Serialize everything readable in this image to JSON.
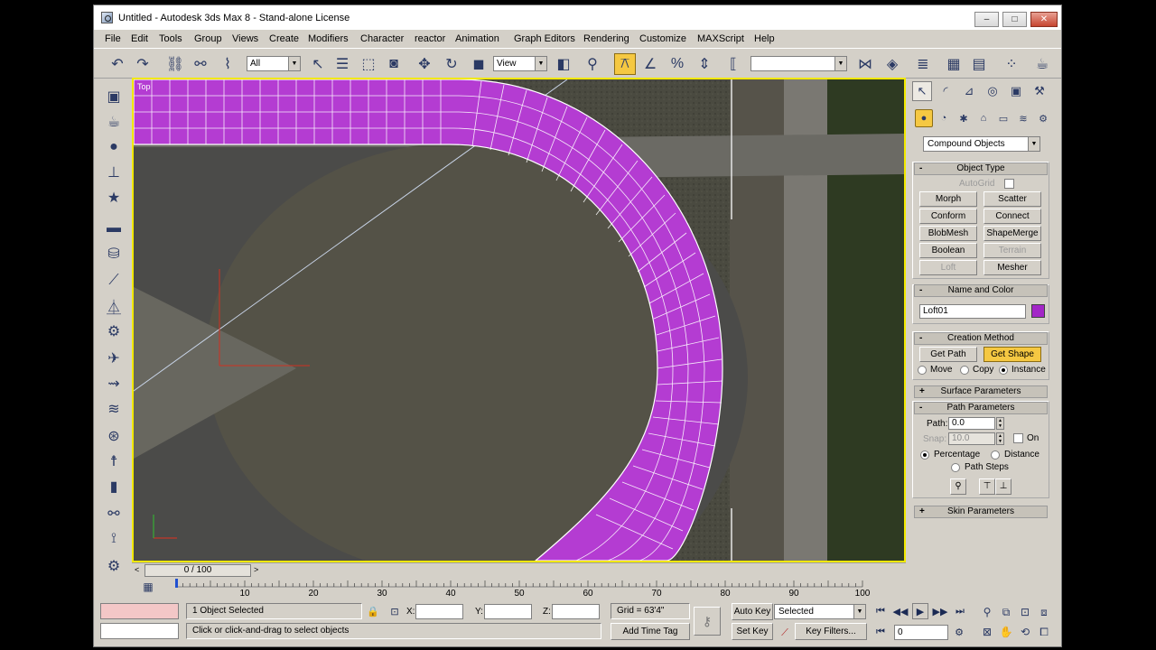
{
  "window": {
    "title": "Untitled - Autodesk 3ds Max 8  - Stand-alone License",
    "minimize": "–",
    "maximize": "□",
    "close": "✕"
  },
  "menu": [
    "File",
    "Edit",
    "Tools",
    "Group",
    "Views",
    "Create",
    "Modifiers",
    "Character",
    "reactor",
    "Animation",
    "Graph Editors",
    "Rendering",
    "Customize",
    "MAXScript",
    "Help"
  ],
  "toolbar": {
    "selection_filter": "All",
    "reference_coord": "View",
    "named_selection": ""
  },
  "viewport": {
    "label": "Top",
    "loft_color": "#b43cd2",
    "active_border_color": "#f2e900"
  },
  "command_panel": {
    "category": "Compound Objects",
    "object_type": {
      "title": "Object Type",
      "autogrid_label": "AutoGrid",
      "buttons": [
        "Morph",
        "Scatter",
        "Conform",
        "Connect",
        "BlobMesh",
        "ShapeMerge",
        "Boolean",
        "Terrain",
        "Loft",
        "Mesher"
      ]
    },
    "name_and_color": {
      "title": "Name and Color",
      "name": "Loft01",
      "color": "#a326c7"
    },
    "creation_method": {
      "title": "Creation Method",
      "get_path": "Get Path",
      "get_shape": "Get Shape",
      "move": "Move",
      "copy": "Copy",
      "instance": "Instance"
    },
    "surface_parameters": "Surface Parameters",
    "path_parameters": {
      "title": "Path Parameters",
      "path_label": "Path:",
      "path_value": "0.0",
      "snap_label": "Snap:",
      "snap_value": "10.0",
      "on_label": "On",
      "percentage": "Percentage",
      "distance": "Distance",
      "path_steps": "Path Steps"
    },
    "skin_parameters": "Skin Parameters"
  },
  "timeline": {
    "slider_label": "0 / 100",
    "ticks": [
      "10",
      "20",
      "30",
      "40",
      "50",
      "60",
      "70",
      "80",
      "90",
      "100"
    ]
  },
  "status": {
    "selection": "1 Object Selected",
    "prompt": "Click or click-and-drag to select objects",
    "x_label": "X:",
    "y_label": "Y:",
    "z_label": "Z:",
    "grid": "Grid = 63'4\"",
    "add_time_tag": "Add Time Tag",
    "auto_key": "Auto Key",
    "set_key": "Set Key",
    "key_mode": "Selected",
    "key_filters": "Key Filters...",
    "frame": "0"
  }
}
